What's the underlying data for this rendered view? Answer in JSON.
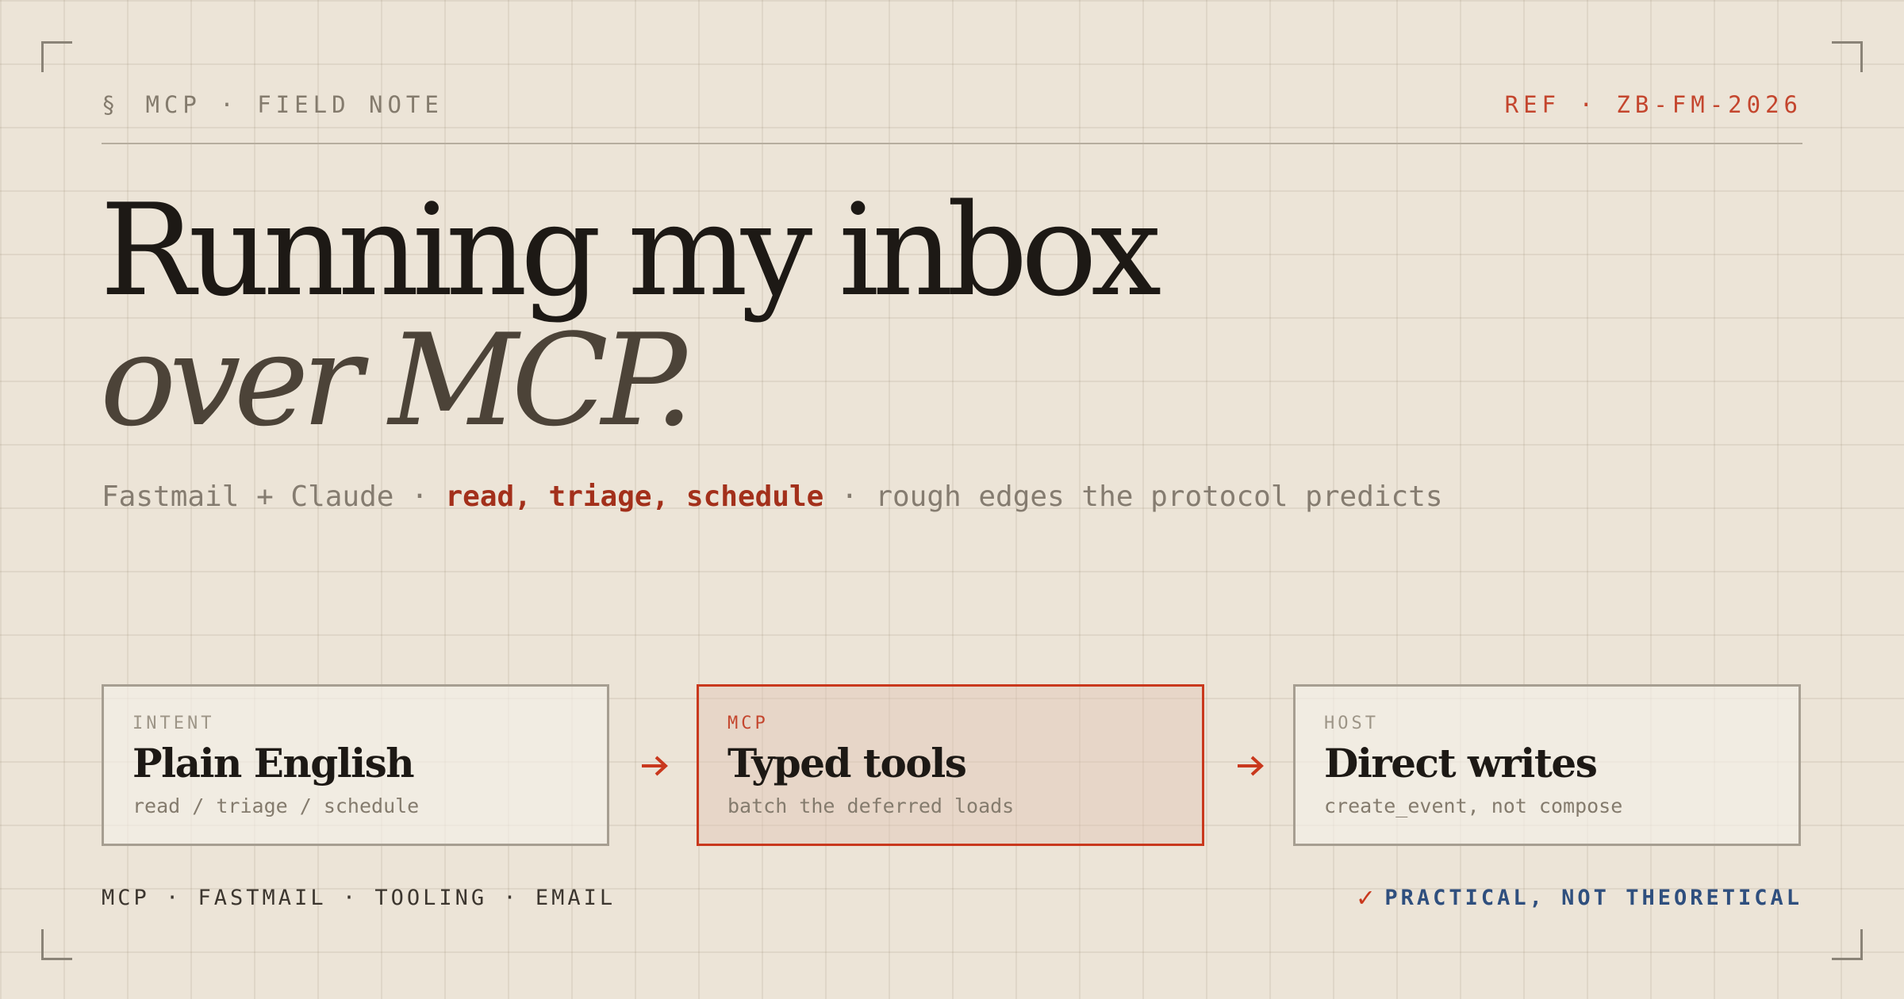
{
  "header": {
    "section_mark": "§",
    "label": "MCP · FIELD NOTE",
    "ref": "REF · ZB-FM-2026"
  },
  "headline": {
    "line1": "Running my inbox",
    "line2": "over MCP."
  },
  "subtitle": {
    "part1": "Fastmail + Claude · ",
    "highlight": "read, triage, schedule",
    "part2": " · rough edges the protocol predicts"
  },
  "flow": [
    {
      "kicker": "INTENT",
      "title": "Plain English",
      "desc": "read / triage / schedule"
    },
    {
      "kicker": "MCP",
      "title": "Typed tools",
      "desc": "batch the deferred loads"
    },
    {
      "kicker": "HOST",
      "title": "Direct writes",
      "desc": "create_event, not compose"
    }
  ],
  "footer": {
    "tags": "MCP · FASTMAIL · TOOLING · EMAIL",
    "check": "✓",
    "verdict": "PRACTICAL, NOT THEORETICAL"
  },
  "colors": {
    "background": "#ece4d7",
    "accent_red": "#c9381d",
    "accent_blue": "#2f4f7e",
    "ink": "#1d1915"
  },
  "icons": {
    "arrow": "arrow-right-icon",
    "check": "check-icon",
    "corners": "corner-bracket-icon"
  }
}
